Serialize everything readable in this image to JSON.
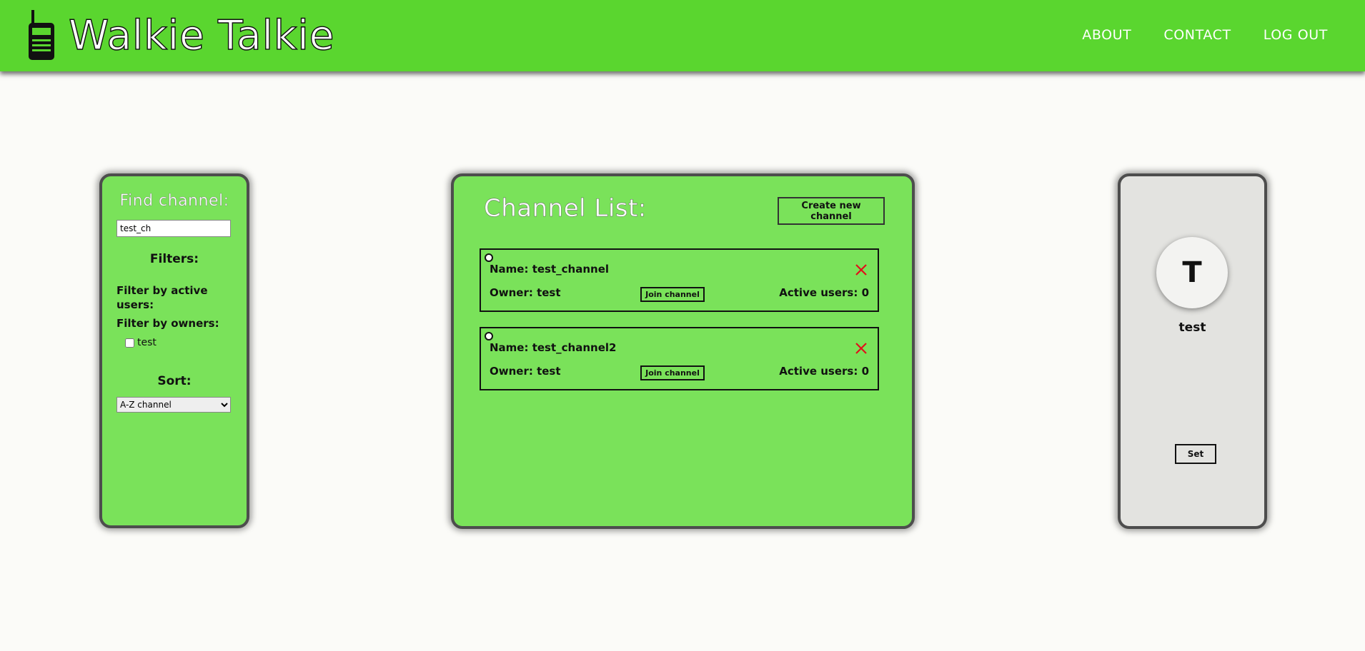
{
  "header": {
    "app_title": "Walkie Talkie",
    "logo_icon": "walkie-talkie-icon",
    "nav": [
      {
        "label": "ABOUT"
      },
      {
        "label": "CONTACT"
      },
      {
        "label": "LOG OUT"
      }
    ],
    "colors": {
      "background": "#5ad62f",
      "text": "#ffffff"
    }
  },
  "find_panel": {
    "title": "Find channel:",
    "search_value": "test_ch",
    "filters_heading": "Filters:",
    "filter_active_label": "Filter by active users:",
    "filter_owners_label": "Filter by owners:",
    "owners": [
      {
        "label": "test",
        "checked": false
      }
    ],
    "sort_heading": "Sort:",
    "sort_selected": "A-Z channel"
  },
  "channel_panel": {
    "title": "Channel List:",
    "create_button": "Create new channel",
    "channels": [
      {
        "name": "Name: test_channel",
        "owner": "Owner: test",
        "join": "Join channel",
        "active": "Active users: 0"
      },
      {
        "name": "Name: test_channel2",
        "owner": "Owner: test",
        "join": "Join channel",
        "active": "Active users: 0"
      }
    ],
    "colors": {
      "panel": "#7ae25a",
      "delete": "#e0101a"
    }
  },
  "profile_panel": {
    "avatar_initial": "T",
    "username": "test",
    "set_button": "Set"
  }
}
